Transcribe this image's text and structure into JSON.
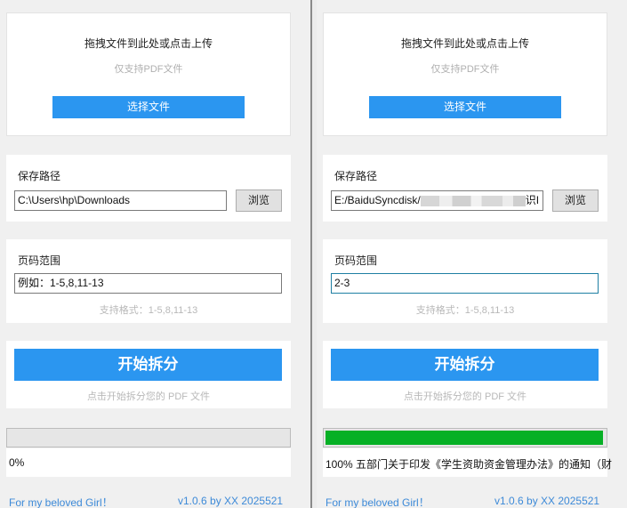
{
  "panes": [
    {
      "upload_title": "拖拽文件到此处或点击上传",
      "upload_hint": "仅支持PDF文件",
      "select_button": "选择文件",
      "save_label": "保存路径",
      "save_path": "C:\\Users\\hp\\Downloads",
      "save_path_suffix": "",
      "browse_button": "浏览",
      "range_label": "页码范围",
      "range_value": "例如：1-5,8,11-13",
      "range_format_hint": "支持格式：1-5,8,11-13",
      "start_button": "开始拆分",
      "start_hint": "点击开始拆分您的 PDF 文件",
      "progress": 0,
      "status_text": "0%",
      "footer_left": "For my beloved Girl！",
      "footer_right": "v1.0.6 by XX 2025521"
    },
    {
      "upload_title": "拖拽文件到此处或点击上传",
      "upload_hint": "仅支持PDF文件",
      "select_button": "选择文件",
      "save_label": "保存路径",
      "save_path": "E:/BaiduSyncdisk/",
      "save_path_suffix": "识I",
      "browse_button": "浏览",
      "range_label": "页码范围",
      "range_value": "2-3",
      "range_format_hint": "支持格式：1-5,8,11-13",
      "start_button": "开始拆分",
      "start_hint": "点击开始拆分您的 PDF 文件",
      "progress": 1,
      "status_text": "100% 五部门关于印发《学生资助资金管理办法》的通知（财",
      "footer_left": "For my beloved Girl！",
      "footer_right": "v1.0.6 by XX 2025521"
    }
  ],
  "colors": {
    "accent": "#2b96f0",
    "progress_fill": "#06b025",
    "link": "#3d8ad8"
  }
}
